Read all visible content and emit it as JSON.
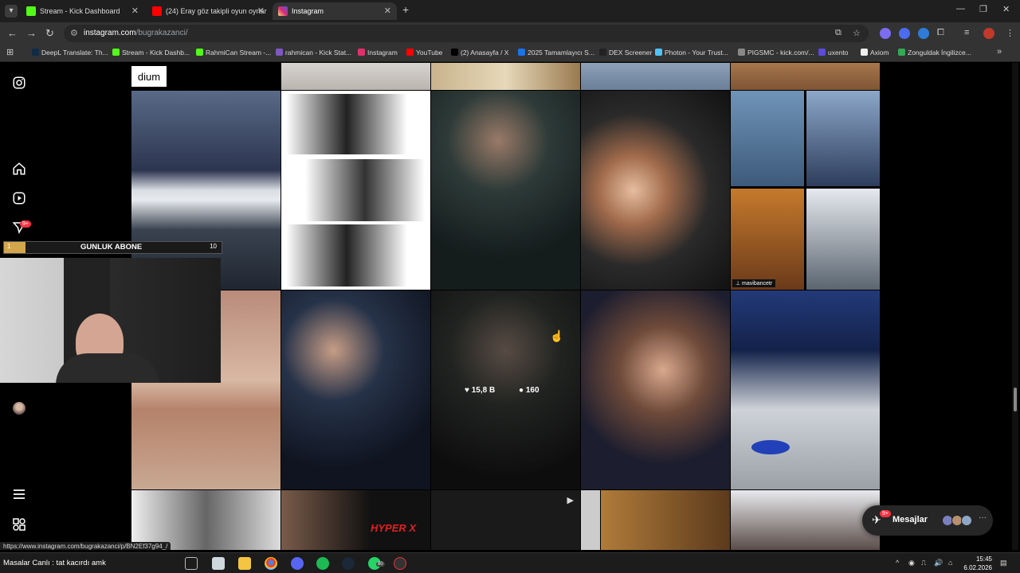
{
  "tabs": [
    {
      "label": "Stream - Kick Dashboard",
      "favicon": "kick-icon",
      "color": "#53fc18"
    },
    {
      "label": "(24) Eray göz takipli oyun oynar",
      "favicon": "youtube-icon",
      "color": "#ff0000"
    },
    {
      "label": "Instagram",
      "favicon": "instagram-icon",
      "color": "#e1306c",
      "active": true
    }
  ],
  "address": {
    "host": "instagram.com",
    "path": "/bugrakazanci/"
  },
  "bookmarks": [
    {
      "label": "DeepL Translate: Th...",
      "color": "#0f2b46"
    },
    {
      "label": "Stream - Kick Dashb...",
      "color": "#53fc18"
    },
    {
      "label": "RahmiCan Stream -...",
      "color": "#53fc18"
    },
    {
      "label": "rahmican - Kick Stat...",
      "color": "#7e57c2"
    },
    {
      "label": "Instagram",
      "color": "#e1306c"
    },
    {
      "label": "YouTube",
      "color": "#ff0000"
    },
    {
      "label": "(2) Anasayfa / X",
      "color": "#000000"
    },
    {
      "label": "2025 Tamamlayıcı S...",
      "color": "#1a73e8"
    },
    {
      "label": "DEX Screener",
      "color": "#222222"
    },
    {
      "label": "Photon - Your Trust...",
      "color": "#4fc3f7"
    },
    {
      "label": "PIGSMC - kick.com/...",
      "color": "#888888"
    },
    {
      "label": "uxento",
      "color": "#5b4bdb"
    },
    {
      "label": "Axiom",
      "color": "#eeeeee"
    },
    {
      "label": "Zonguldak İngilizce...",
      "color": "#34a853"
    }
  ],
  "grid_overlays": {
    "dium_label": "dium",
    "mavibancetr": "mavibancetr",
    "likes": "15,8 B",
    "comments": "160"
  },
  "stream_overlay": {
    "goal_title": "GUNLUK ABONE",
    "goal_current": "1",
    "goal_target": "10",
    "progress_fraction": 0.1
  },
  "messages": {
    "label": "Mesajlar",
    "badge": "9+"
  },
  "sidebar_notif_badge": "9+",
  "status_url": "https://www.instagram.com/bugrakazanci/p/BN2Ef37g94_/",
  "taskbar": {
    "ticker": "Masalar Canlı : tat kacırdı amk",
    "whatsapp_badge": "80",
    "time": "15:45",
    "date": "6.02.2026"
  },
  "colors": {
    "accent": "#0095f6",
    "notif": "#ff3040",
    "goal": "#d3a64b"
  }
}
